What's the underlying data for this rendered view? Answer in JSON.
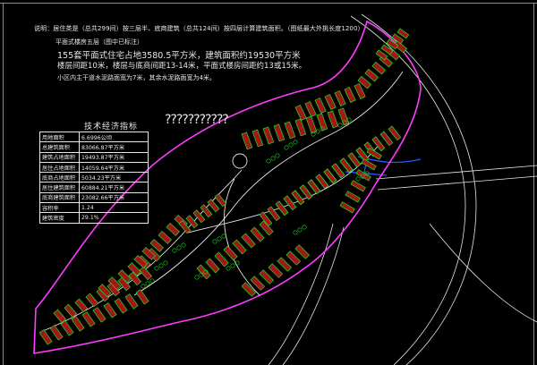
{
  "notes": {
    "line1": "说明：居住类是（总共299间）按三层半、底商建筑（总共124间）按四层计算建筑面积。（图纸最大外挑长度1200）",
    "line2": "平面式楼房五层（图中已标注）",
    "line3": "155套平面式住宅占地3580.5平方米，建筑面积约19530平方米",
    "line4": "楼层间距10米，楼层与底商间距13-14米，平面式楼房间距约13或15米。",
    "line5": "小区内主干道水泥路面宽为7米，其余水泥路面宽为4米。"
  },
  "unreadable_label": "???????????",
  "table": {
    "title": "技术经济指标",
    "rows": [
      {
        "key": "用地面积",
        "value": "6.6996公顷"
      },
      {
        "key": "总建筑面积",
        "value": "83066.87平方米"
      },
      {
        "key": "建筑占地面积",
        "value": "19493.87平方米"
      },
      {
        "key": "居住占地面积",
        "value": "14059.64平方米"
      },
      {
        "key": "底商占地面积",
        "value": "5034.23平方米"
      },
      {
        "key": "居住建筑面积",
        "value": "60884.21平方米"
      },
      {
        "key": "底商建筑面积",
        "value": "23082.66平方米"
      },
      {
        "key": "容积率",
        "value": "1.24"
      },
      {
        "key": "建筑密度",
        "value": "29.1%"
      }
    ]
  },
  "colors": {
    "background": "#000000",
    "text": "#e8e8e8",
    "boundary": "#ff3cff",
    "buildings": "#22dd22",
    "building_fill": "#a01818",
    "roads": "#e8e8e8",
    "river": "#2a5cff",
    "frame": "#8b8b8b"
  }
}
